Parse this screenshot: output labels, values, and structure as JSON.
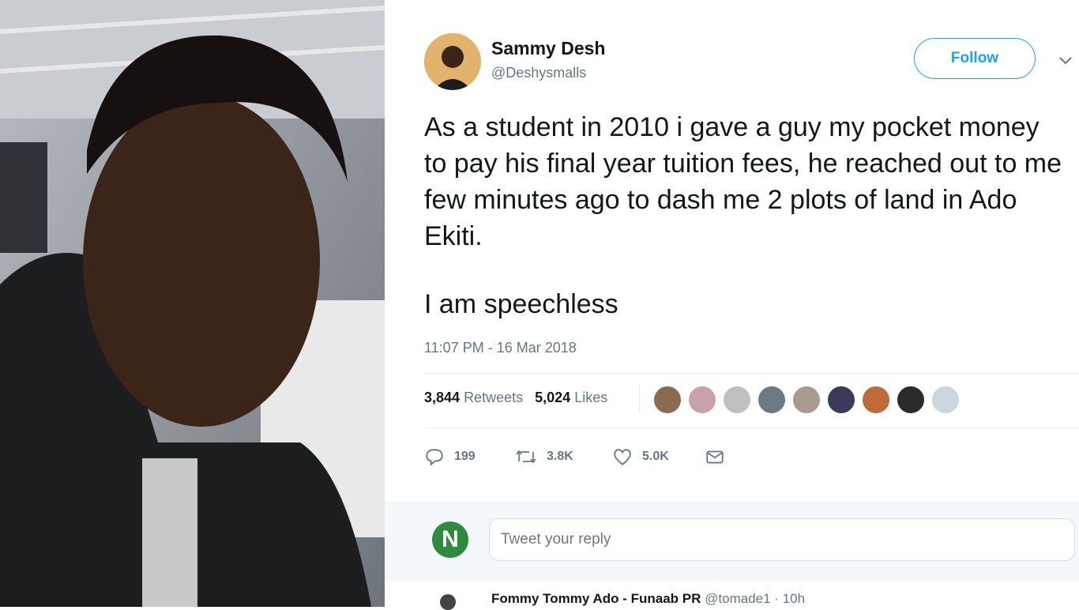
{
  "tweet": {
    "author_name": "Sammy Desh",
    "author_handle": "@Deshysmalls",
    "follow_label": "Follow",
    "body": "As a student in 2010 i gave a guy my pocket money to pay his final year tuition fees, he reached out to me few minutes ago to dash me 2 plots of land in Ado Ekiti.",
    "body2": "I am speechless",
    "timestamp": "11:07 PM - 16 Mar 2018",
    "retweets_count": "3,844",
    "retweets_label": "Retweets",
    "likes_count": "5,024",
    "likes_label": "Likes"
  },
  "actions": {
    "reply_count": "199",
    "retweet_count": "3.8K",
    "like_count": "5.0K"
  },
  "reply": {
    "logo_letter": "N",
    "placeholder": "Tweet your reply"
  },
  "next_reply": {
    "name": "Fommy Tommy Ado - Funaab PR",
    "handle": "@tomade1 · 10h"
  },
  "colors": {
    "accent": "#1da1f2",
    "text": "#14171a",
    "muted": "#657786"
  },
  "icons": [
    "chevron-down-icon",
    "reply-icon",
    "retweet-icon",
    "like-icon",
    "message-icon"
  ]
}
